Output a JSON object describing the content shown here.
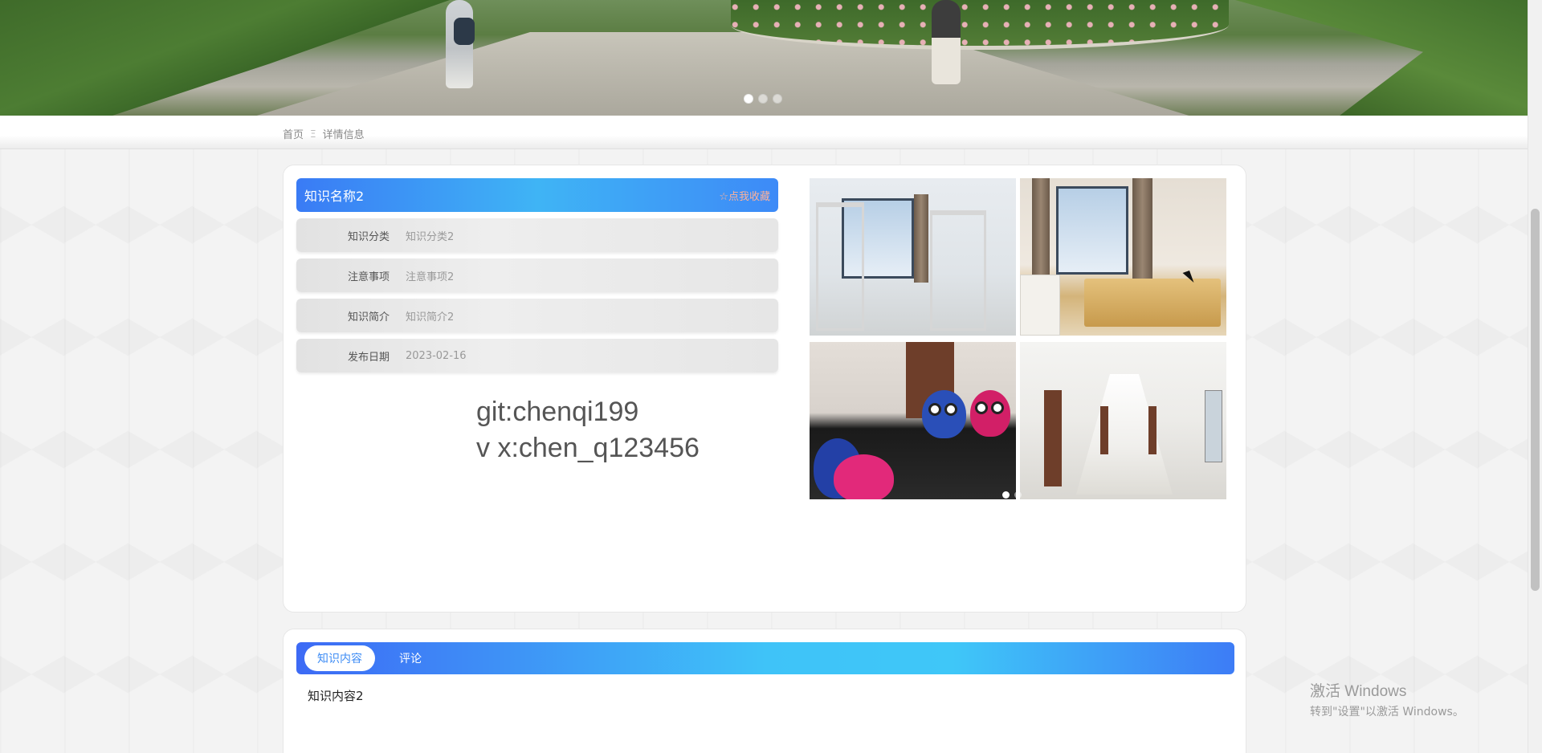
{
  "banner": {
    "slide_count": 3,
    "active_slide": 1
  },
  "breadcrumb": {
    "home": "首页",
    "separator": "Ξ",
    "current": "详情信息"
  },
  "detail": {
    "title": "知识名称2",
    "collect_label": "☆点我收藏",
    "fields": [
      {
        "label": "知识分类",
        "value": "知识分类2"
      },
      {
        "label": "注意事项",
        "value": "注意事项2"
      },
      {
        "label": "知识简介",
        "value": "知识简介2"
      },
      {
        "label": "发布日期",
        "value": "2023-02-16"
      }
    ],
    "watermark_line1": "git:chenqi199",
    "watermark_line2": "v x:chen_q123456"
  },
  "gallery": {
    "images": [
      "dorm-room-bunks",
      "dorm-room-bed",
      "dorm-desk-toys",
      "dorm-corridor"
    ],
    "active_slide": 1,
    "slide_count": 2
  },
  "tabs": {
    "items": [
      {
        "label": "知识内容",
        "active": true
      },
      {
        "label": "评论",
        "active": false
      }
    ]
  },
  "content": {
    "text": "知识内容2"
  },
  "os_watermark": {
    "line1": "激活 Windows",
    "line2": "转到\"设置\"以激活 Windows。"
  },
  "colors": {
    "accent_blue": "#3a7bf5",
    "accent_cyan": "#3fc3f8",
    "collect_text": "#ffb199"
  }
}
